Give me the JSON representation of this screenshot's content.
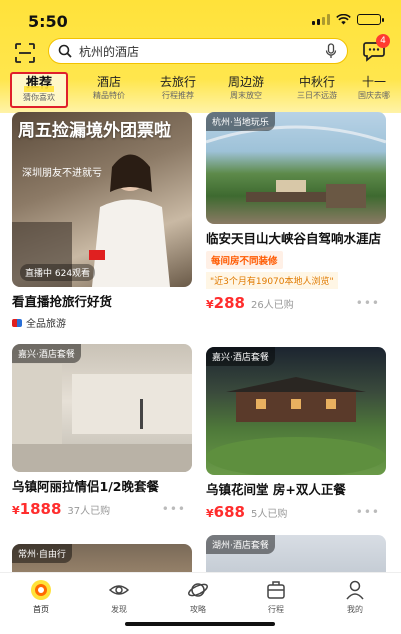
{
  "status": {
    "time": "5:50"
  },
  "search": {
    "placeholder_text": "杭州的酒店",
    "badge_count": "4"
  },
  "tabs": [
    {
      "label": "推荐",
      "sub": "猜你喜欢",
      "active": true
    },
    {
      "label": "酒店",
      "sub": "精品特价"
    },
    {
      "label": "去旅行",
      "sub": "行程推荐"
    },
    {
      "label": "周边游",
      "sub": "周末放空"
    },
    {
      "label": "中秋行",
      "sub": "三日不远游"
    },
    {
      "label": "十一",
      "sub": "国庆去哪"
    }
  ],
  "cards": {
    "c1": {
      "overlay_title": "周五捡漏境外团票啦",
      "overlay_sub": "深圳朋友不进就亏",
      "live_badge": "直播中 624观看",
      "title": "看直播抢旅行好货",
      "vendor": "全品旅游"
    },
    "c2": {
      "tag": "杭州·当地玩乐",
      "title": "临安天目山大峡谷自驾响水涯店",
      "chip": "每间房不同装修",
      "hint": "\"近3个月有19070本地人浏览\"",
      "price_symbol": "¥",
      "price": "288",
      "sold": "26人已购"
    },
    "c3": {
      "tag": "嘉兴·酒店套餐",
      "title": "乌镇阿丽拉情侣1/2晚套餐",
      "price_symbol": "¥",
      "price": "1888",
      "sold": "37人已购"
    },
    "c4": {
      "tag": "嘉兴·酒店套餐",
      "title": "乌镇花间堂 房+双人正餐",
      "price_symbol": "¥",
      "price": "688",
      "sold": "5人已购"
    },
    "c5": {
      "tag": "常州·自由行"
    },
    "c6": {
      "tag": "湖州·酒店套餐"
    }
  },
  "nav": [
    {
      "label": "首页",
      "icon": "home-icon"
    },
    {
      "label": "发现",
      "icon": "eye-icon"
    },
    {
      "label": "攻略",
      "icon": "planet-icon"
    },
    {
      "label": "行程",
      "icon": "suitcase-icon"
    },
    {
      "label": "我的",
      "icon": "user-icon"
    }
  ],
  "colors": {
    "brand_yellow": "#ffe23a",
    "price_red": "#ff2d2d",
    "active_tab_border": "#e0202a"
  }
}
